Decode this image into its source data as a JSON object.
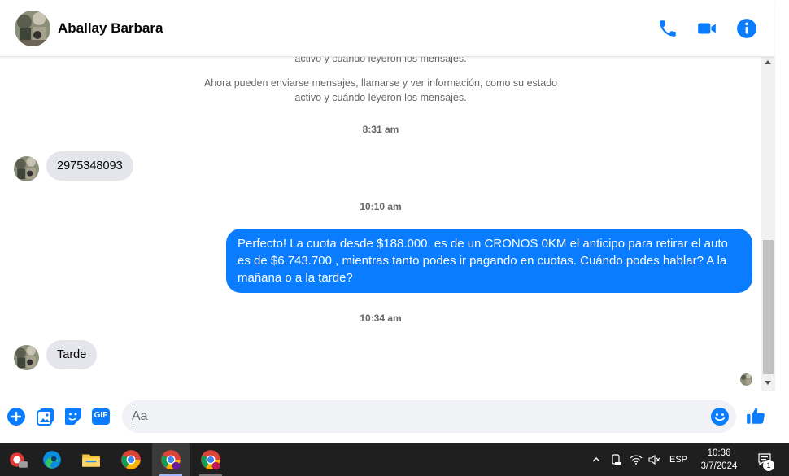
{
  "header": {
    "contact_name": "Aballay Barbara",
    "icons": [
      "phone-icon",
      "video-icon",
      "info-icon"
    ]
  },
  "conversation": {
    "system_partial": "activo y cuándo leyeron los mensajes.",
    "system_line1": "Ahora pueden enviarse mensajes, llamarse y ver información, como su estado",
    "system_line2": "activo y cuándo leyeron los mensajes.",
    "messages": [
      {
        "time": "8:31 am",
        "direction": "in",
        "text": "2975348093"
      },
      {
        "time": "10:10 am",
        "direction": "out",
        "text": "Perfecto! La cuota desde $188.000. es de un CRONOS 0KM el anticipo para retirar el auto es de $6.743.700 , mientras tanto podes ir pagando en cuotas. Cuándo podes hablar? A la mañana o a la tarde?"
      },
      {
        "time": "10:34 am",
        "direction": "in",
        "text": "Tarde"
      }
    ]
  },
  "composer": {
    "placeholder": "Aa",
    "icons": [
      "plus-icon",
      "photo-icon",
      "sticker-icon",
      "gif-icon",
      "emoji-icon",
      "like-icon"
    ],
    "gif_label": "GIF"
  },
  "taskbar": {
    "apps": [
      "app-icon",
      "edge-icon",
      "file-explorer-icon",
      "chrome-icon",
      "chrome-profile-icon",
      "chrome-profile-2-icon"
    ],
    "language": "ESP",
    "time": "10:36",
    "date": "3/7/2024",
    "notification_count": "1"
  },
  "colors": {
    "accent": "#0a7cff",
    "bubble_in": "#e4e6eb",
    "taskbar": "#1f1f1f"
  }
}
